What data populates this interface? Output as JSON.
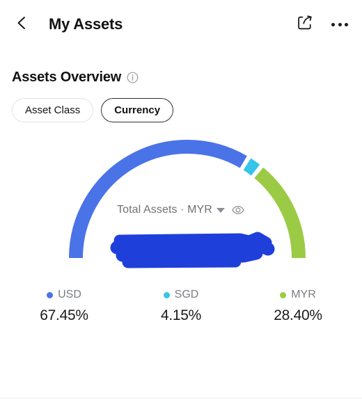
{
  "header": {
    "back_icon": "chevron-left-icon",
    "title": "My Assets",
    "share_icon": "share-icon",
    "more_icon": "more-horizontal-icon"
  },
  "overview": {
    "title": "Assets Overview",
    "info_icon": "info-circle-icon",
    "tabs": [
      {
        "label": "Asset Class",
        "selected": false
      },
      {
        "label": "Currency",
        "selected": true
      }
    ]
  },
  "gauge": {
    "total_label": "Total Assets · MYR",
    "caret_icon": "chevron-down-icon",
    "visibility_icon": "eye-icon",
    "amount_value": "",
    "amount_redacted": true,
    "redaction_color": "#1f3fdb"
  },
  "chart_data": {
    "type": "pie",
    "title": "Assets Overview",
    "subtype": "half-donut-gauge",
    "categories": [
      "USD",
      "SGD",
      "MYR"
    ],
    "values": [
      67.45,
      4.15,
      28.4
    ],
    "value_labels": [
      "67.45%",
      "4.15%",
      "28.40%"
    ],
    "colors": [
      "#4a73e8",
      "#35c5e8",
      "#9bcb45"
    ],
    "legend_position": "bottom",
    "grid": false,
    "units": "percent",
    "start_angle_deg": 180,
    "sweep_deg": 180
  },
  "legend": [
    {
      "name": "USD",
      "value": "67.45%",
      "color": "#4a73e8"
    },
    {
      "name": "SGD",
      "value": "4.15%",
      "color": "#35c5e8"
    },
    {
      "name": "MYR",
      "value": "28.40%",
      "color": "#9bcb45"
    }
  ]
}
